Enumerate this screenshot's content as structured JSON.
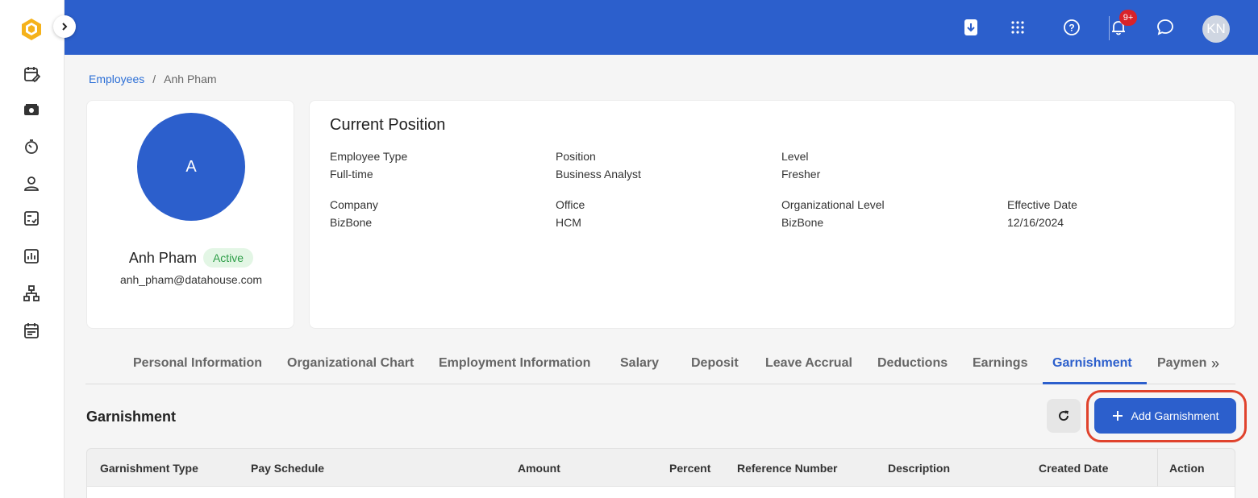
{
  "topbar": {
    "avatar_initials": "KN",
    "notification_count": "9+"
  },
  "breadcrumb": {
    "parent": "Employees",
    "separator": "/",
    "current": "Anh Pham"
  },
  "profile": {
    "avatar_letter": "A",
    "name": "Anh Pham",
    "status": "Active",
    "email": "anh_pham@datahouse.com"
  },
  "position": {
    "title": "Current Position",
    "fields": [
      {
        "label": "Employee Type",
        "value": "Full-time"
      },
      {
        "label": "Position",
        "value": "Business Analyst"
      },
      {
        "label": "Level",
        "value": "Fresher"
      },
      {
        "label": "Company",
        "value": "BizBone"
      },
      {
        "label": "Office",
        "value": "HCM"
      },
      {
        "label": "Organizational Level",
        "value": "BizBone"
      },
      {
        "label": "Effective Date",
        "value": "12/16/2024"
      }
    ]
  },
  "tabs": [
    {
      "label": "Personal Information"
    },
    {
      "label": "Organizational Chart"
    },
    {
      "label": "Employment Information"
    },
    {
      "label": "Salary"
    },
    {
      "label": "Deposit"
    },
    {
      "label": "Leave Accrual"
    },
    {
      "label": "Deductions"
    },
    {
      "label": "Earnings"
    },
    {
      "label": "Garnishment"
    },
    {
      "label": "Payments"
    }
  ],
  "active_tab": "Garnishment",
  "tabs_more": "»",
  "section": {
    "title": "Garnishment",
    "add_button": "Add Garnishment"
  },
  "table": {
    "columns": [
      "Garnishment Type",
      "Pay Schedule",
      "Amount",
      "Percent",
      "Reference Number",
      "Description",
      "Created Date",
      "Action"
    ]
  },
  "colors": {
    "primary": "#2c5fcc",
    "highlight": "#e0432d",
    "status_green": "#2e9e48"
  },
  "icons": {
    "sidebar": [
      "calendar-edit-icon",
      "money-icon",
      "timer-icon",
      "person-icon",
      "checklist-icon",
      "report-chart-icon",
      "org-chart-icon",
      "schedule-icon"
    ],
    "topbar": [
      "download-icon",
      "apps-grid-icon",
      "help-icon",
      "bell-icon",
      "chat-icon"
    ]
  }
}
